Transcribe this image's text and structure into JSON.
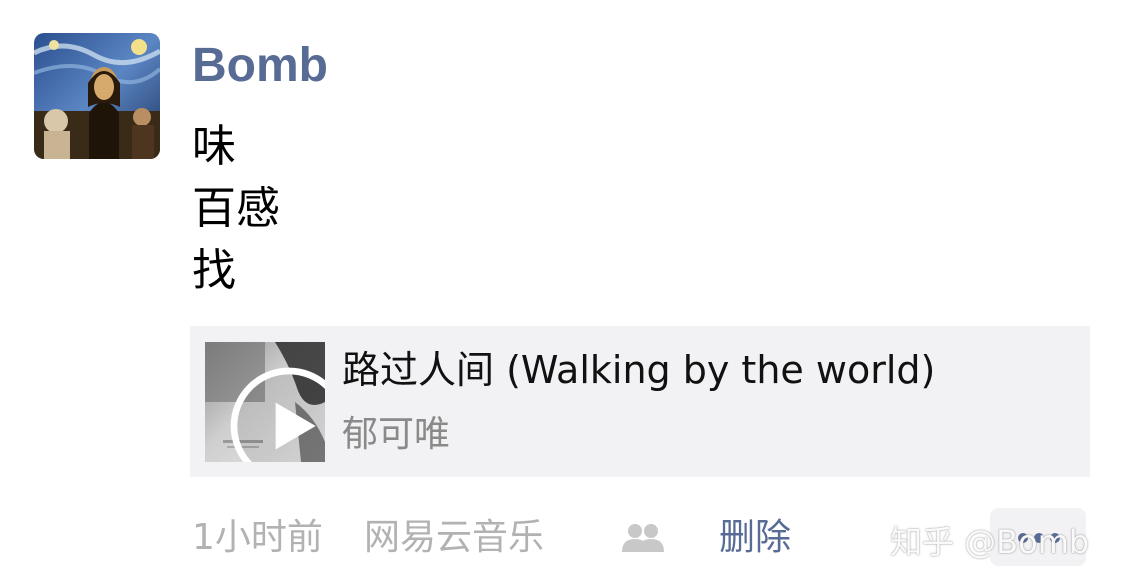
{
  "post": {
    "username": "Bomb",
    "avatar_icon": "avatar-painting-icon",
    "text_lines": [
      "味",
      "百感",
      "找"
    ]
  },
  "music_card": {
    "title": "路过人间 (Walking by the world)",
    "artist": "郁可唯",
    "play_icon": "play-icon"
  },
  "footer": {
    "time": "1小时前",
    "source": "网易云音乐",
    "friends_icon": "friends-icon",
    "delete_label": "删除",
    "more_icon": "more-icon"
  },
  "watermark": "知乎 @Bomb",
  "colors": {
    "link": "#576b95",
    "meta": "#b2b2b2",
    "card_bg": "#f2f2f4"
  }
}
